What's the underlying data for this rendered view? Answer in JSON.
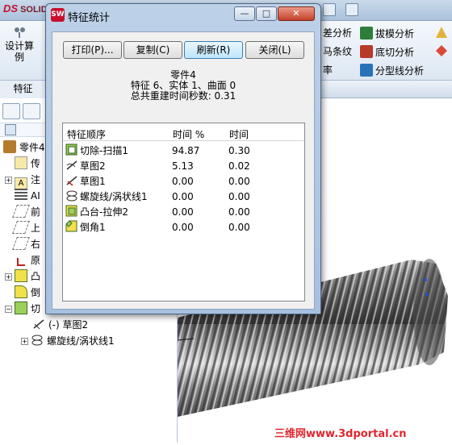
{
  "app": {
    "logo_text": "SOLIDWORKS",
    "design_button_label": "设计算例",
    "ribbon_tab": "特征",
    "ribbon_right": [
      {
        "label": "拔模分析",
        "color": "#2f7d3a"
      },
      {
        "label": "底切分析",
        "color": "#b83a28"
      },
      {
        "label": "分型线分析",
        "color": "#2a72b8"
      }
    ],
    "ribbon_left_partial": [
      "差分析",
      "马条纹",
      "率"
    ]
  },
  "tree": {
    "root": "零件4",
    "items": [
      {
        "label": "传",
        "icon": "sensor-icon"
      },
      {
        "label": "注",
        "icon": "annotation-icon"
      },
      {
        "label": "AI",
        "icon": "material-icon"
      },
      {
        "label": "前",
        "icon": "plane-icon"
      },
      {
        "label": "上",
        "icon": "plane-icon"
      },
      {
        "label": "右",
        "icon": "plane-icon"
      },
      {
        "label": "原",
        "icon": "origin-icon"
      },
      {
        "label": "凸",
        "icon": "extrude-icon"
      },
      {
        "label": "倒",
        "icon": "fillet-icon"
      },
      {
        "label": "切",
        "icon": "cut-sweep-icon"
      },
      {
        "label": "(-) 草图2",
        "icon": "sketch-icon"
      },
      {
        "label": "螺旋线/涡状线1",
        "icon": "helix-icon"
      }
    ]
  },
  "watermark": "三维网www.3dportal.cn",
  "dialog": {
    "title": "特征统计",
    "buttons": {
      "print": "打印(P)...",
      "copy": "复制(C)",
      "refresh": "刷新(R)",
      "close": "关闭(L)"
    },
    "part_name": "零件4",
    "summary": "特征 6、实体 1、曲面 0",
    "rebuild_time": "总共重建时间秒数: 0.31",
    "columns": {
      "order": "特征顺序",
      "pct": "时间 %",
      "time": "时间"
    },
    "rows": [
      {
        "name": "切除-扫描1",
        "pct": "94.87",
        "time": "0.30",
        "icon": "cut-sweep-icon"
      },
      {
        "name": "草图2",
        "pct": "5.13",
        "time": "0.02",
        "icon": "sketch-icon"
      },
      {
        "name": "草图1",
        "pct": "0.00",
        "time": "0.00",
        "icon": "sketch-icon"
      },
      {
        "name": "螺旋线/涡状线1",
        "pct": "0.00",
        "time": "0.00",
        "icon": "helix-icon"
      },
      {
        "name": "凸台-拉伸2",
        "pct": "0.00",
        "time": "0.00",
        "icon": "extrude-icon"
      },
      {
        "name": "倒角1",
        "pct": "0.00",
        "time": "0.00",
        "icon": "chamfer-icon"
      }
    ]
  }
}
